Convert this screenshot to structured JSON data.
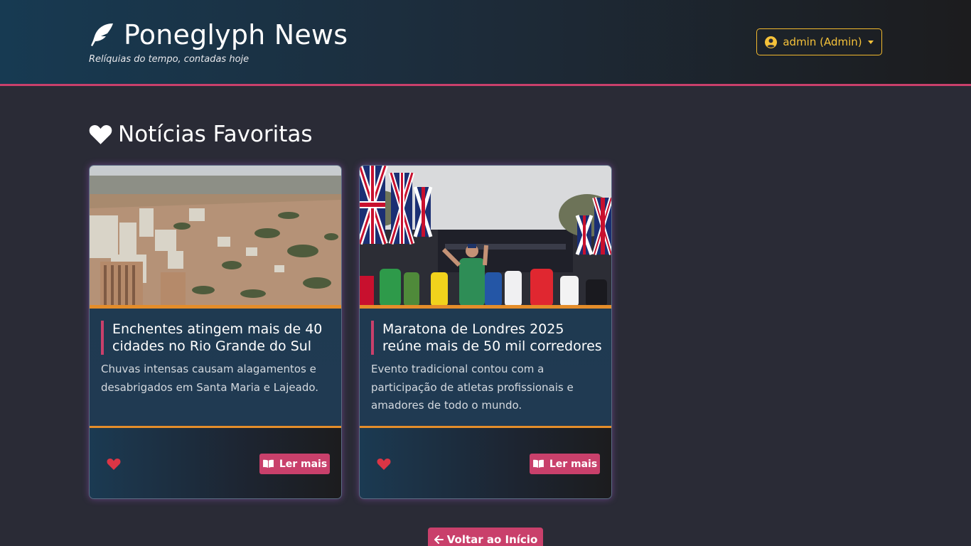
{
  "header": {
    "title": "Poneglyph News",
    "tagline": "Relíquias do tempo, contadas hoje",
    "logo_icon": "feather-icon",
    "user_menu_label": "admin (Admin)",
    "user_icon": "user-circle-icon"
  },
  "section": {
    "title": "Notícias Favoritas",
    "icon": "heart-icon"
  },
  "cards": [
    {
      "image": "flooded-city-aerial-photo",
      "title": "Enchentes atingem mais de 40 cidades no Rio Grande do Sul",
      "summary": "Chuvas intensas causam alagamentos e desabrigados em Santa Maria e Lajeado.",
      "favorite_icon": "heart-icon",
      "read_more_label": "Ler mais",
      "read_more_icon": "book-open-icon"
    },
    {
      "image": "london-marathon-runners-photo",
      "title": "Maratona de Londres 2025 reúne mais de 50 mil corredores",
      "summary": "Evento tradicional contou com a participação de atletas profissionais e amadores de todo o mundo.",
      "favorite_icon": "heart-icon",
      "read_more_label": "Ler mais",
      "read_more_icon": "book-open-icon"
    }
  ],
  "back_button": {
    "label": "Voltar ao Início",
    "icon": "arrow-left-icon"
  },
  "colors": {
    "accent_pink": "#c9406b",
    "accent_orange": "#e48d2a",
    "user_yellow": "#f5c23a",
    "heart_red": "#dc3545",
    "page_bg": "#2a2b36"
  }
}
